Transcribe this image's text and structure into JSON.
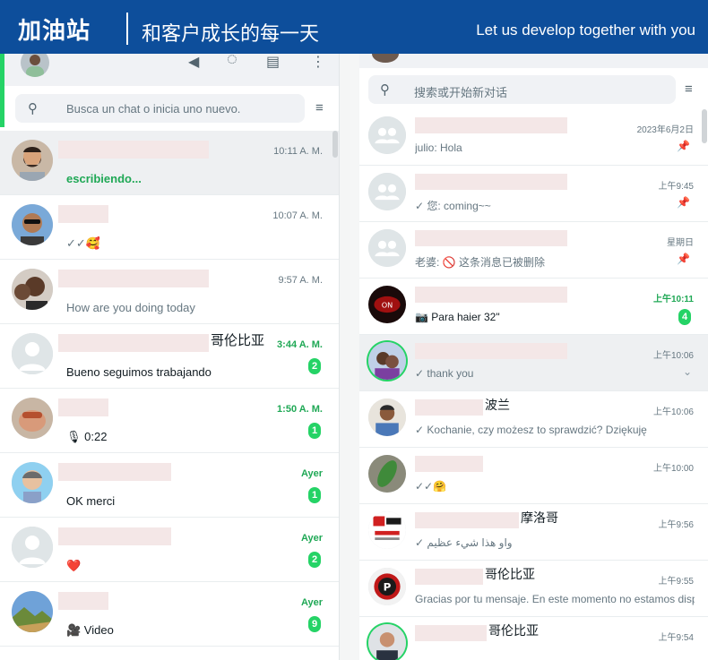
{
  "banner": {
    "title": "加油站",
    "subtitle": "和客户成长的每一天",
    "slogan": "Let us develop together with you",
    "color": "#0d4e9b"
  },
  "left": {
    "search_placeholder": "Busca un chat o inicia uno nuevo.",
    "chats": [
      {
        "name": "",
        "time": "10:11 A. M.",
        "message": "escribiendo...",
        "typing": true,
        "selected": true,
        "avatar": "bearded-man"
      },
      {
        "name": "",
        "time": "10:07 A. M.",
        "message": "✓✓🥰",
        "avatar": "man-sunglasses"
      },
      {
        "name": "",
        "time": "9:57 A. M.",
        "message": "How are you doing today",
        "avatar": "smiling-man"
      },
      {
        "name": "哥伦比亚",
        "time": "3:44 A. M.",
        "time_green": true,
        "message": "Bueno seguimos trabajando",
        "dark": true,
        "unread": "2",
        "avatar": "default"
      },
      {
        "name": "",
        "time": "1:50 A. M.",
        "time_green": true,
        "message": "🎙 0:22",
        "dark": true,
        "unread": "1",
        "avatar": "hand"
      },
      {
        "name": "",
        "time": "Ayer",
        "time_green": true,
        "message": "OK merci",
        "dark": true,
        "unread": "1",
        "avatar": "cartoon"
      },
      {
        "name": "",
        "time": "Ayer",
        "time_green": true,
        "message": "❤️",
        "unread": "2",
        "avatar": "default"
      },
      {
        "name": "",
        "time": "Ayer",
        "time_green": true,
        "message": "🎥 Video",
        "dark": true,
        "unread": "9",
        "avatar": "landscape"
      }
    ]
  },
  "right": {
    "search_placeholder": "搜索或开始新对话",
    "chats": [
      {
        "name": "",
        "time": "2023年6月2日",
        "message": "julio: Hola",
        "pinned": true,
        "avatar": "group"
      },
      {
        "name": "",
        "time": "上午9:45",
        "message": "✓ 您: coming~~",
        "pinned": true,
        "avatar": "group"
      },
      {
        "name": "",
        "time": "星期日",
        "message": "老婆: 🚫 这条消息已被删除",
        "pinned": true,
        "avatar": "group"
      },
      {
        "name": "",
        "time": "上午10:11",
        "time_green": true,
        "message": "📷 Para haier 32\"",
        "dark": true,
        "unread": "4",
        "avatar": "dark-logo"
      },
      {
        "name": "",
        "time": "上午10:06",
        "message": "✓ thank you",
        "selected": true,
        "chevron": true,
        "ring": true,
        "avatar": "couple"
      },
      {
        "name": "波兰",
        "time": "上午10:06",
        "message": "✓ Kochanie, czy możesz to sprawdzić? Dziękuję",
        "avatar": "man-shirt"
      },
      {
        "name": "",
        "time": "上午10:00",
        "message": "✓✓🤗",
        "avatar": "green-object"
      },
      {
        "name": "摩洛哥",
        "time": "上午9:56",
        "message": "✓ واو هذا شيء عظيم",
        "avatar": "store-logo"
      },
      {
        "name": "哥伦比亚",
        "time": "上午9:55",
        "message": "Gracias por tu mensaje. En este momento no estamos disp...",
        "avatar": "red-logo"
      },
      {
        "name": "哥伦比亚",
        "time": "上午9:54",
        "message": "",
        "ring": true,
        "avatar": "man-suit"
      }
    ]
  }
}
